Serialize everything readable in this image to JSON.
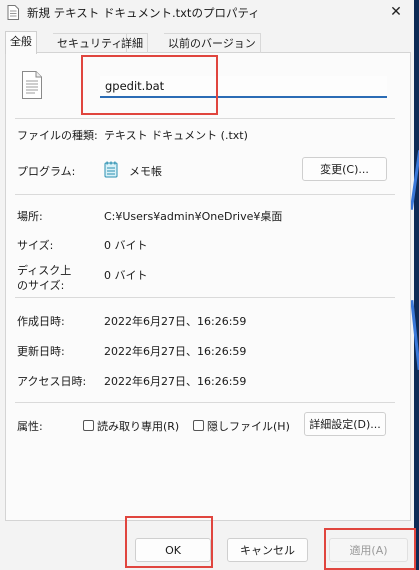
{
  "window": {
    "title": "新規 テキスト ドキュメント.txtのプロパティ",
    "close_glyph": "✕"
  },
  "tabs": [
    {
      "label": "全般",
      "selected": true
    },
    {
      "label": "セキュリティ",
      "selected": false
    },
    {
      "label": "詳細",
      "selected": false
    },
    {
      "label": "以前のバージョン",
      "selected": false
    }
  ],
  "general": {
    "file_name": "gpedit.bat",
    "file_type_label": "ファイルの種類:",
    "file_type_value": "テキスト ドキュメント (.txt)",
    "program_label": "プログラム:",
    "program_value": "メモ帳",
    "change_button": "変更(C)...",
    "location_label": "場所:",
    "location_value": "C:¥Users¥admin¥OneDrive¥桌面",
    "size_label": "サイズ:",
    "size_value": "0 バイト",
    "disk_size_label_line1": "ディスク上",
    "disk_size_label_line2": "のサイズ:",
    "disk_size_value": "0 バイト",
    "created_label": "作成日時:",
    "created_value": "2022年6月27日、16:26:59",
    "modified_label": "更新日時:",
    "modified_value": "2022年6月27日、16:26:59",
    "accessed_label": "アクセス日時:",
    "accessed_value": "2022年6月27日、16:26:59",
    "attributes_label": "属性:",
    "readonly_label": "読み取り専用(R)",
    "hidden_label": "隠しファイル(H)",
    "advanced_button": "詳細設定(D)..."
  },
  "footer": {
    "ok_button": "OK",
    "cancel_button": "キャンセル",
    "apply_button": "適用(A)"
  },
  "colors": {
    "highlight": "#e0453e",
    "accent": "#2b6cb5"
  }
}
